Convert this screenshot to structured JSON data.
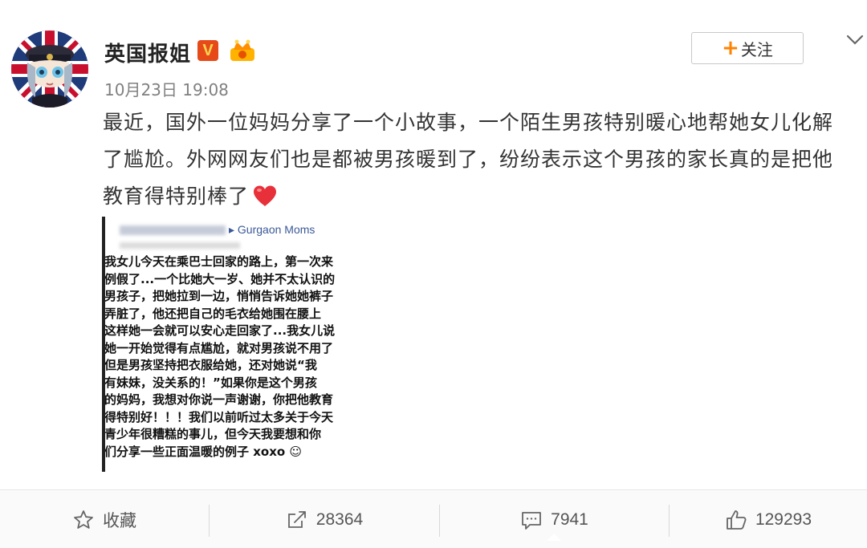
{
  "post": {
    "author": "英国报姐",
    "vip_badge": "V",
    "timestamp": "10月23日 19:08",
    "follow_label": "关注",
    "follow_plus": "+",
    "text_lines": [
      "最近，国外一位妈妈分享了一个小故事，一个陌生男孩特别暖心地帮她女儿化解",
      "了尴尬。外网网友们也是都被男孩暖到了，纷纷表示这个男孩的家长真的是把他",
      "教育得特别棒了"
    ],
    "embedded_image": {
      "group_name": "Gurgaon Moms",
      "separator": "▸",
      "lines": [
        "我女儿今天在乘巴士回家的路上，第一次来",
        "例假了...一个比她大一岁、她并不太认识的",
        "男孩子，把她拉到一边，悄悄告诉她她裤子",
        "弄脏了，他还把自己的毛衣给她围在腰上",
        "这样她一会就可以安心走回家了...我女儿说",
        "她一开始觉得有点尴尬，就对男孩说不用了",
        "但是男孩坚持把衣服给她，还对她说“我",
        "有妹妹，没关系的！”如果你是这个男孩",
        "的妈妈，我想对你说一声谢谢，你把他教育",
        "得特别好！！！我们以前听过太多关于今天",
        "青少年很糟糕的事儿，但今天我要想和你",
        "们分享一些正面温暖的例子 xoxo ☺"
      ]
    }
  },
  "actions": {
    "favorite_label": "收藏",
    "repost_count": "28364",
    "comment_count": "7941",
    "like_count": "129293"
  },
  "icons": {
    "avatar": "avatar-union-jack-girl",
    "vip": "verified-v-icon",
    "crown": "crown-badge-icon",
    "more": "chevron-down-icon",
    "heart": "red-heart-emoji",
    "favorite": "star-icon",
    "repost": "share-icon",
    "comment": "comment-icon",
    "like": "thumbs-up-icon"
  },
  "colors": {
    "accent_orange": "#ff8200",
    "heart_red": "#e8303a",
    "facebook_blue": "#3b5998",
    "vip_red": "#e64a19"
  }
}
